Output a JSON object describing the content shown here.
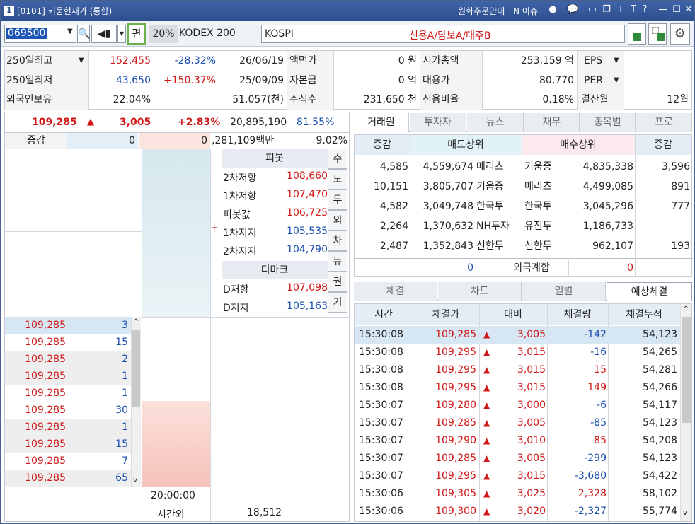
{
  "title": {
    "num": "1",
    "text": "[0101] 키움현재가 (통합)",
    "notice": "원화주문안내",
    "issue": "N 이슈",
    "icons": [
      "kakao-icon",
      "chat-icon",
      "window-icon",
      "copy-icon",
      "pin-icon",
      "text-icon",
      "help-icon",
      "minimize-icon",
      "maximize-icon",
      "close-icon"
    ],
    "t_label": "T",
    "q_label": "?"
  },
  "toolbar": {
    "code": "069500",
    "pen": "편",
    "rate": "20%",
    "name": "KODEX 200",
    "market": "KOSPI",
    "credit": "신용A/담보A/대주B"
  },
  "info": {
    "r1": {
      "l1": "250일최고",
      "v1": "152,455",
      "p1": "-28.32%",
      "d1": "26/06/19",
      "l2": "액면가",
      "v2": "0 원",
      "l3": "시가총액",
      "v3": "253,159 억",
      "l4": "EPS",
      "v4": ""
    },
    "r2": {
      "l1": "250일최저",
      "v1": "43,650",
      "p1": "+150.37%",
      "d1": "25/09/09",
      "l2": "자본금",
      "v2": "0 억",
      "l3": "대용가",
      "v3": "80,770",
      "l4": "PER",
      "v4": ""
    },
    "r3": {
      "l1": "외국인보유",
      "v1": "22.04%",
      "v2": "51,057(천)",
      "l2": "주식수",
      "v2b": "231,650 천",
      "l3": "신용비율",
      "v3": "0.18%",
      "l4": "결산월",
      "v4": "12월"
    }
  },
  "price": {
    "cur": "109,285",
    "chg": "3,005",
    "pct": "+2.83%",
    "vol": "20,895,190",
    "ratio": "81.55%",
    "row2_l": "증감",
    "row2_a": "0",
    "row2_b": "0",
    "row2_c": ",281,109백만",
    "row2_d": "9.02%"
  },
  "pivot": {
    "title": "피봇",
    "rows": [
      {
        "k": "2차저항",
        "v": "108,660"
      },
      {
        "k": "1차저항",
        "v": "107,470"
      },
      {
        "k": "피봇값",
        "v": "106,725"
      },
      {
        "k": "1차지지",
        "v": "105,535"
      },
      {
        "k": "2차지지",
        "v": "104,790"
      }
    ],
    "dmark": "디마크",
    "drows": [
      {
        "k": "D저항",
        "v": "107,098"
      },
      {
        "k": "D지지",
        "v": "105,163"
      }
    ]
  },
  "side_buttons": [
    "수",
    "도",
    "투",
    "외",
    "차",
    "뉴",
    "권",
    "기"
  ],
  "left_ticks": [
    {
      "p": "109,285",
      "q": "3"
    },
    {
      "p": "109,285",
      "q": "15"
    },
    {
      "p": "109,285",
      "q": "2"
    },
    {
      "p": "109,285",
      "q": "1"
    },
    {
      "p": "109,285",
      "q": "1"
    },
    {
      "p": "109,285",
      "q": "30"
    },
    {
      "p": "109,285",
      "q": "1"
    },
    {
      "p": "109,285",
      "q": "15"
    },
    {
      "p": "109,285",
      "q": "7"
    },
    {
      "p": "109,285",
      "q": "65"
    }
  ],
  "bottom": {
    "time": "20:00:00",
    "after": "시간외",
    "after_v": "18,512"
  },
  "broker_tabs": [
    "거래원",
    "투자자",
    "뉴스",
    "재무",
    "종목별",
    "프로"
  ],
  "broker": {
    "h": [
      "증감",
      "매도상위",
      "매수상위",
      "증감"
    ],
    "rows": [
      {
        "a": "4,585",
        "s": "4,559,674",
        "sn": "메리츠",
        "bn": "키움증",
        "b": "4,835,338",
        "c": "3,596"
      },
      {
        "a": "10,151",
        "s": "3,805,707",
        "sn": "키움증",
        "bn": "메리츠",
        "b": "4,499,085",
        "c": "891"
      },
      {
        "a": "4,582",
        "s": "3,049,748",
        "sn": "한국투",
        "bn": "한국투",
        "b": "3,045,296",
        "c": "777"
      },
      {
        "a": "2,264",
        "s": "1,370,632",
        "sn": "NH투자",
        "bn": "유진투",
        "b": "1,186,733",
        "c": ""
      },
      {
        "a": "2,487",
        "s": "1,352,843",
        "sn": "신한투",
        "bn": "신한투",
        "b": "962,107",
        "c": "193"
      }
    ],
    "foreign_s": "0",
    "foreign": "외국계합",
    "foreign_b": "0"
  },
  "trade_tabs": [
    "체결",
    "차트",
    "일별",
    "예상체결"
  ],
  "trades": {
    "h": [
      "시간",
      "체결가",
      "대비",
      "체결량",
      "체결누적"
    ],
    "rows": [
      {
        "t": "15:30:08",
        "p": "109,285",
        "d": "3,005",
        "q": "-142",
        "c": "54,123"
      },
      {
        "t": "15:30:08",
        "p": "109,295",
        "d": "3,015",
        "q": "-16",
        "c": "54,265"
      },
      {
        "t": "15:30:08",
        "p": "109,295",
        "d": "3,015",
        "q": "15",
        "c": "54,281"
      },
      {
        "t": "15:30:08",
        "p": "109,295",
        "d": "3,015",
        "q": "149",
        "c": "54,266"
      },
      {
        "t": "15:30:07",
        "p": "109,280",
        "d": "3,000",
        "q": "-6",
        "c": "54,117"
      },
      {
        "t": "15:30:07",
        "p": "109,285",
        "d": "3,005",
        "q": "-85",
        "c": "54,123"
      },
      {
        "t": "15:30:07",
        "p": "109,290",
        "d": "3,010",
        "q": "85",
        "c": "54,208"
      },
      {
        "t": "15:30:07",
        "p": "109,285",
        "d": "3,005",
        "q": "-299",
        "c": "54,123"
      },
      {
        "t": "15:30:07",
        "p": "109,295",
        "d": "3,015",
        "q": "-3,680",
        "c": "54,422"
      },
      {
        "t": "15:30:06",
        "p": "109,305",
        "d": "3,025",
        "q": "2,328",
        "c": "58,102"
      },
      {
        "t": "15:30:06",
        "p": "109,300",
        "d": "3,020",
        "q": "-2,327",
        "c": "55,774"
      }
    ]
  }
}
